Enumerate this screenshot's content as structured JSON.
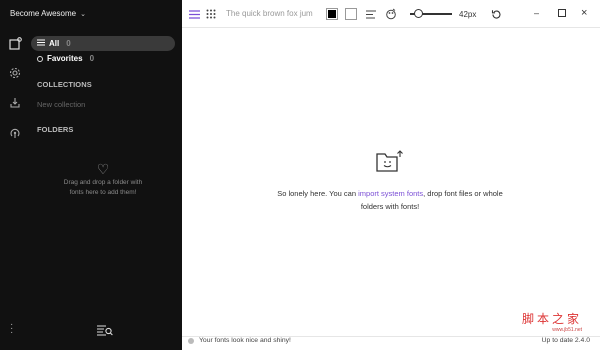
{
  "account": {
    "name": "Become Awesome"
  },
  "nav": {
    "all": {
      "label": "All",
      "count": "0"
    },
    "favorites": {
      "label": "Favorites",
      "count": "0"
    }
  },
  "collections": {
    "heading": "COLLECTIONS",
    "new": "New collection"
  },
  "folders": {
    "heading": "FOLDERS",
    "drop_line1": "Drag and drop a folder with",
    "drop_line2": "fonts here to add them!"
  },
  "toolbar": {
    "preview_text": "The quick brown fox jum",
    "size": "42px",
    "size_value": 42,
    "colors": {
      "text": "#000000",
      "background": "#ffffff"
    }
  },
  "empty": {
    "part1": "So lonely here. You can ",
    "link": "import system fonts",
    "part2": ", drop font files or whole",
    "line2": "folders with fonts!"
  },
  "status": {
    "message": "Your fonts look nice and shiny!",
    "version": "Up to date 2.4.0"
  },
  "watermark": {
    "big": "脚本之家",
    "small": "www.jb51.net"
  },
  "accent": "#7b4fd6"
}
